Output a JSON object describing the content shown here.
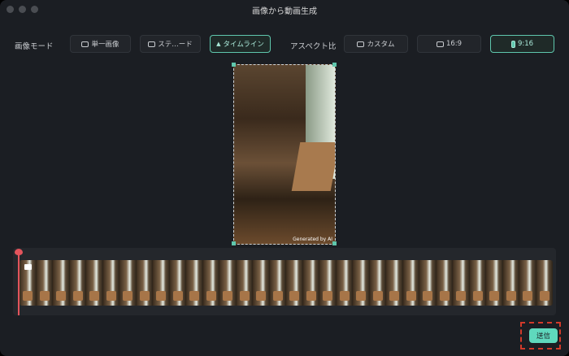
{
  "window": {
    "title": "画像から動画生成"
  },
  "image_mode": {
    "label": "画像モード",
    "options": [
      {
        "label": "単一画像",
        "icon": "image-icon",
        "selected": false
      },
      {
        "label": "ステ…ード",
        "icon": "image-icon",
        "selected": false
      },
      {
        "label": "タイムライン",
        "icon": "timeline-icon",
        "selected": true
      }
    ]
  },
  "aspect_ratio": {
    "label": "アスペクト比",
    "options": [
      {
        "label": "カスタム",
        "icon": "landscape-icon",
        "selected": false
      },
      {
        "label": "16:9",
        "icon": "landscape-icon",
        "selected": false
      },
      {
        "label": "9:16",
        "icon": "portrait-icon",
        "selected": true
      }
    ]
  },
  "preview": {
    "watermark": "Generated by AI"
  },
  "footer": {
    "send_label": "送信"
  },
  "colors": {
    "accent": "#5fc7ad",
    "playhead": "#e2545c",
    "highlight": "#d23a2a"
  }
}
